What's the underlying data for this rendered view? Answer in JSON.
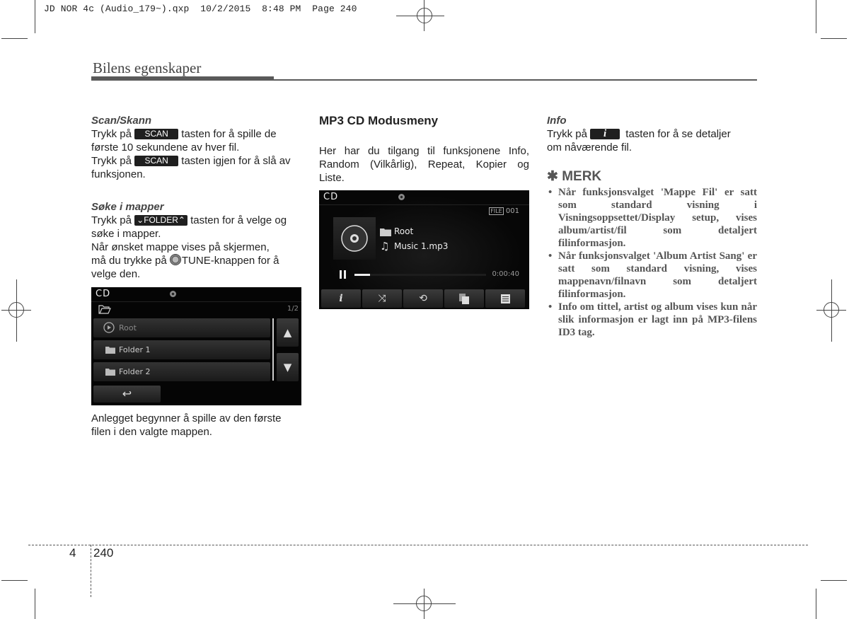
{
  "print_slug": "JD NOR 4c (Audio_179~).qxp  10/2/2015  8:48 PM  Page 240",
  "header": {
    "title": "Bilens egenskaper"
  },
  "col1": {
    "scan": {
      "heading": "Scan/Skann",
      "p1_pre": "Trykk på",
      "p1_key": "SCAN",
      "p1_post_a": "tasten for å spille de",
      "p1_post_b": "første 10 sekundene av hver fil.",
      "p2_pre": "Trykk på",
      "p2_key": "SCAN",
      "p2_post_a": "tasten igjen for å slå av",
      "p2_post_b": "funksjonen."
    },
    "folders": {
      "heading": "Søke i mapper",
      "p1_pre": "Trykk på",
      "p1_key": "FOLDER",
      "p1_post_a": "tasten for å velge og",
      "p1_post_b": "søke i mapper.",
      "p2_a": "Når ønsket mappe vises på skjermen,",
      "p2_b_pre": "må du trykke på",
      "p2_b_key": "TUNE-knappen for å",
      "p2_c": "velge den."
    },
    "folder_screen": {
      "mode": "CD",
      "page_indicator": "1/2",
      "items": [
        {
          "label": "Root",
          "icon": "play-circle-icon"
        },
        {
          "label": "Folder 1",
          "icon": "folder-icon"
        },
        {
          "label": "Folder 2",
          "icon": "folder-icon"
        }
      ],
      "scroll_up": "▲",
      "scroll_down": "▼",
      "back": "↩"
    },
    "caption_a": "Anlegget begynner å spille av den første",
    "caption_b": "filen i den valgte mappen."
  },
  "col2": {
    "heading": "MP3 CD Modusmeny",
    "intro_a": "Her har du tilgang til funksjonene Info,",
    "intro_b": "Random (Vilkårlig), Repeat, Kopier og",
    "intro_c": "Liste.",
    "player_screen": {
      "mode": "CD",
      "file_label": "FILE",
      "file_number": "001",
      "folder": "Root",
      "track": "Music 1.mp3",
      "elapsed": "0:00:40",
      "progress_fraction": 0.12,
      "controls": [
        {
          "name": "info",
          "icon": "info-icon"
        },
        {
          "name": "random",
          "icon": "shuffle-icon"
        },
        {
          "name": "repeat",
          "icon": "repeat-icon"
        },
        {
          "name": "copy",
          "icon": "copy-icon"
        },
        {
          "name": "list",
          "icon": "list-icon"
        }
      ]
    }
  },
  "col3": {
    "info": {
      "heading": "Info",
      "p_pre": "Trykk på",
      "p_key": "i",
      "p_post_a": "tasten for å se detaljer",
      "p_post_b": "om nåværende fil."
    },
    "note": {
      "title": "✱ MERK",
      "items": [
        "Når funksjonsvalget 'Mappe Fil' er satt som standard visning i Visningsoppsettet/Display setup, vises album/artist/fil som detaljert filinformasjon.",
        "Når funksjonsvalget 'Album Artist Sang' er satt som standard visning, vises mappenavn/filnavn som detaljert filinformasjon.",
        "Info om tittel, artist og album vises kun når slik informasjon er lagt inn på MP3-filens ID3 tag."
      ]
    }
  },
  "footer": {
    "chapter": "4",
    "page": "240"
  }
}
